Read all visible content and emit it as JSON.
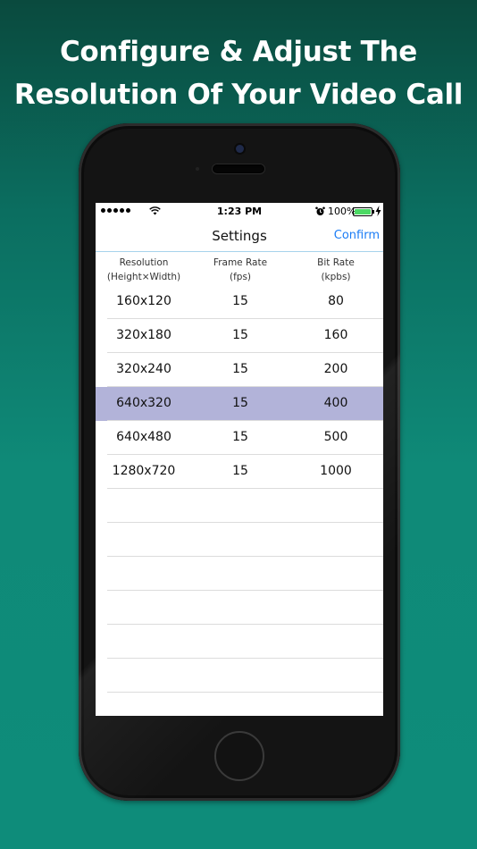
{
  "headline": {
    "line1": "Configure & Adjust The",
    "line2": "Resolution Of Your Video Call"
  },
  "status_bar": {
    "time": "1:23 PM",
    "battery": "100%"
  },
  "navbar": {
    "title": "Settings",
    "confirm_label": "Confirm"
  },
  "table": {
    "headers": [
      {
        "line1": "Resolution",
        "line2": "(Height×Width)"
      },
      {
        "line1": "Frame Rate",
        "line2": "(fps)"
      },
      {
        "line1": "Bit Rate",
        "line2": "(kpbs)"
      }
    ],
    "rows": [
      {
        "resolution": "160x120",
        "fps": "15",
        "bitrate": "80"
      },
      {
        "resolution": "320x180",
        "fps": "15",
        "bitrate": "160"
      },
      {
        "resolution": "320x240",
        "fps": "15",
        "bitrate": "200"
      },
      {
        "resolution": "640x320",
        "fps": "15",
        "bitrate": "400"
      },
      {
        "resolution": "640x480",
        "fps": "15",
        "bitrate": "500"
      },
      {
        "resolution": "1280x720",
        "fps": "15",
        "bitrate": "1000"
      }
    ],
    "selected_index": 3
  },
  "colors": {
    "accent": "#1a7cf5",
    "selected_row": "#b2b3d9",
    "background_top": "#0a4a3e",
    "background_bottom": "#0e8c7a"
  },
  "icons": [
    "signal-dots-icon",
    "wifi-icon",
    "alarm-icon",
    "battery-icon",
    "charging-bolt-icon"
  ]
}
